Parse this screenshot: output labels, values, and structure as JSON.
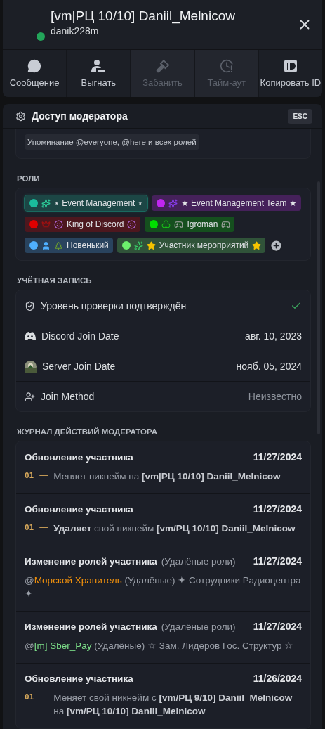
{
  "header": {
    "title": "[vm|РЦ 10/10] Daniil_Melnicow",
    "username": "danik228m",
    "online": true
  },
  "actions": [
    {
      "label": "Сообщение",
      "disabled": false
    },
    {
      "label": "Выгнать",
      "disabled": false
    },
    {
      "label": "Забанить",
      "disabled": true
    },
    {
      "label": "Тайм-аут",
      "disabled": true
    },
    {
      "label": "Копировать ID",
      "disabled": false
    }
  ],
  "moderator_access": {
    "title": "Доступ модератора",
    "shortcut": "ESC",
    "permissions": [
      "Упоминание @everyone, @here и всех ролей"
    ]
  },
  "roles": {
    "heading": "РОЛИ",
    "items": [
      {
        "name": "⋆ Event Management ⋆",
        "color": "#1abc9c",
        "selected": true
      },
      {
        "name": "★ Event Management Team ★",
        "color": "#c026f0",
        "selected": false
      },
      {
        "name": "King of Discord",
        "color": "#e00000",
        "selected": false
      },
      {
        "name": "Igroman",
        "color": "#00e000",
        "selected": false
      },
      {
        "name": "Новенький",
        "color": "#4fb0ff",
        "selected": false
      },
      {
        "name": "Участник мероприятий",
        "color": "#6cf06c",
        "selected": false
      }
    ]
  },
  "account": {
    "heading": "УЧЁТНАЯ ЗАПИСЬ",
    "rows": [
      {
        "label": "Уровень проверки подтверждён",
        "kind": "check"
      },
      {
        "label": "Discord Join Date",
        "kind": "text",
        "value": "авг. 10, 2023"
      },
      {
        "label": "Server Join Date",
        "kind": "text",
        "value": "нояб. 05, 2024"
      },
      {
        "label": "Join Method",
        "kind": "muted",
        "value": "Неизвестно"
      }
    ]
  },
  "mod_log": {
    "heading": "ЖУРНАЛ ДЕЙСТВИЙ МОДЕРАТОРА",
    "entries": [
      {
        "kind": "change",
        "title": "Обновление участника",
        "date": "11/27/2024",
        "number": "01",
        "dash": "—",
        "text": "Меняет никнейм на **[vm|РЦ 10/10] Daniil_Melnicow**"
      },
      {
        "kind": "change",
        "title": "Обновление участника",
        "date": "11/27/2024",
        "number": "01",
        "dash": "—",
        "text": "**Удаляет** свой никнейм **[vm/РЦ 10/10] Daniil_Melnicow**"
      },
      {
        "kind": "roles",
        "title": "Изменение ролей участника",
        "subtitle": "(Удалёные роли)",
        "date": "11/27/2024",
        "at": "@",
        "mention": "Морской Хранитель",
        "color": "#f0900c",
        "text": "(Удалёные) ✦ Сотрудники Радиоцентра ✦"
      },
      {
        "kind": "roles",
        "title": "Изменение ролей участника",
        "subtitle": "(Удалёные роли)",
        "date": "11/27/2024",
        "at": "@",
        "mention": "[m] Sber_Pay",
        "color": "#7ee08a",
        "text": "(Удалёные) ☆ Зам. Лидеров Гос. Структур ☆"
      },
      {
        "kind": "change",
        "title": "Обновление участника",
        "date": "11/26/2024",
        "number": "01",
        "dash": "—",
        "text": "Меняет свой никнейм с **[vm/РЦ 9/10] Daniil_Melnicow** на **[vm/РЦ 10/10] Daniil_Melnicow**"
      }
    ]
  }
}
